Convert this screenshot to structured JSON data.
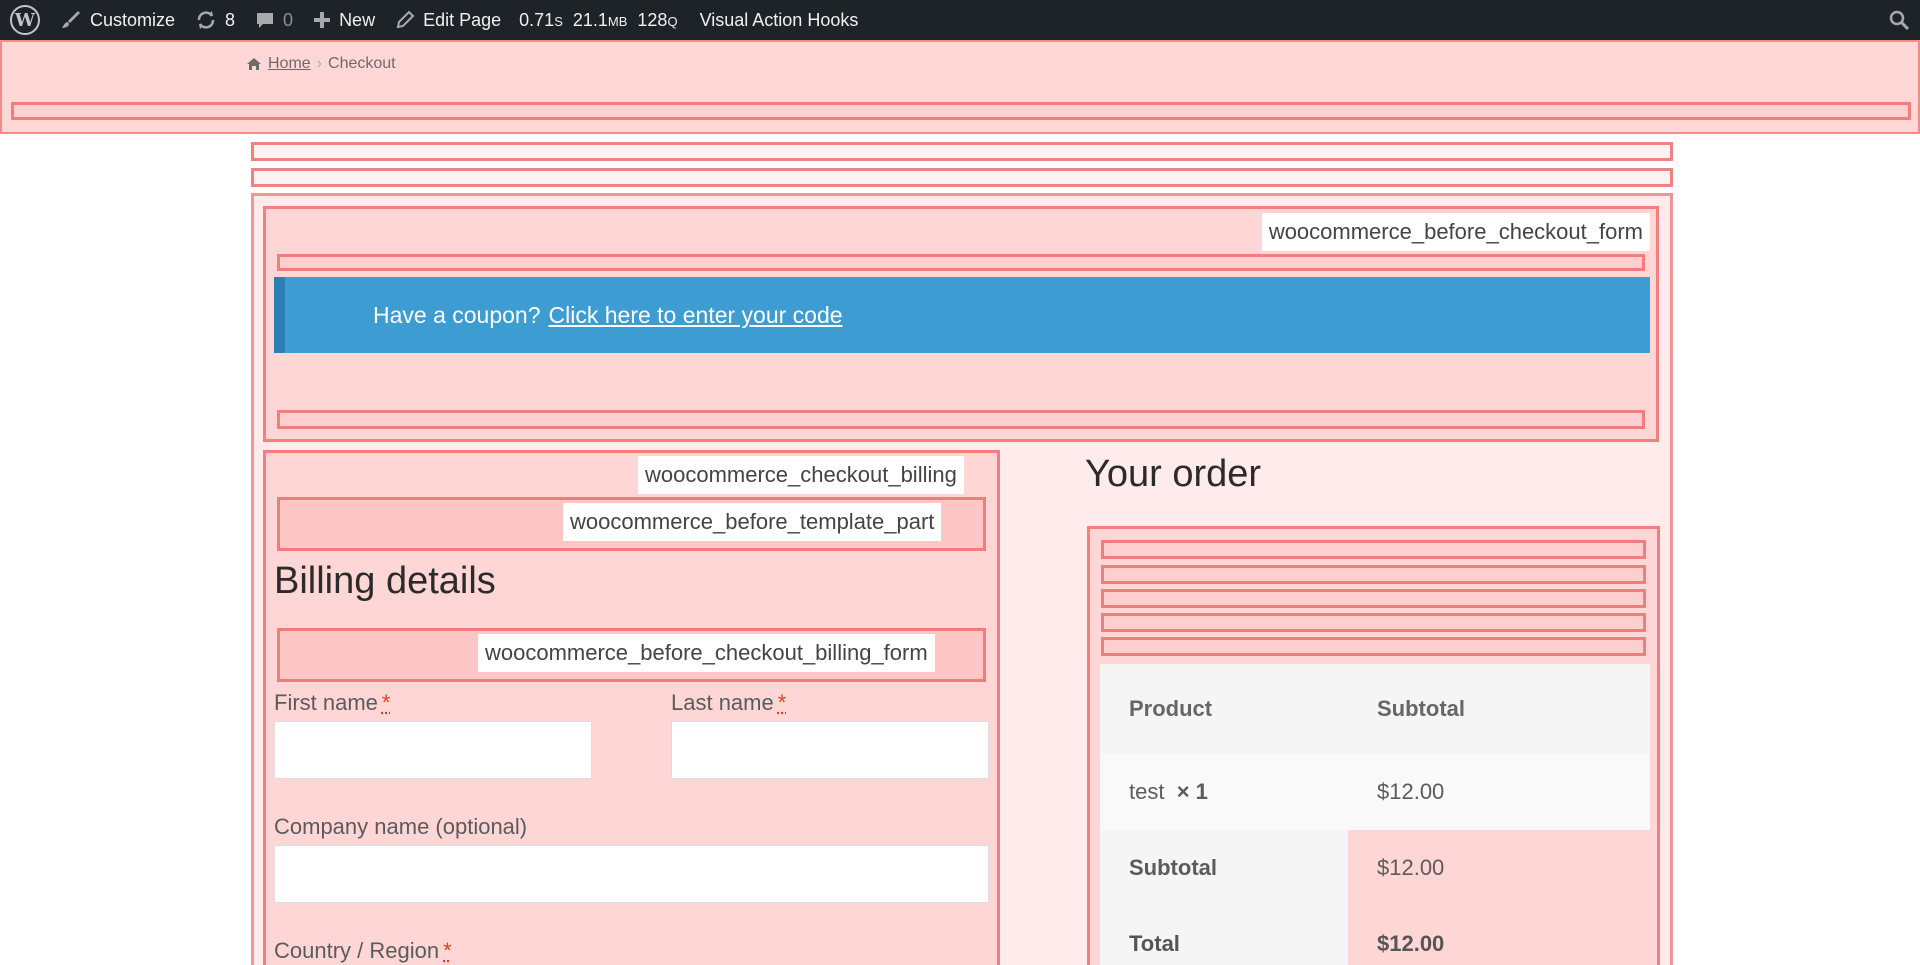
{
  "adminbar": {
    "customize_label": "Customize",
    "updates_count": "8",
    "comments_count": "0",
    "new_label": "New",
    "edit_page_label": "Edit Page",
    "query_time": "0.71",
    "query_time_unit": "S",
    "memory": "21.1",
    "memory_unit": "MB",
    "queries": "128",
    "queries_unit": "Q",
    "plugin_label": "Visual Action Hooks"
  },
  "breadcrumb": {
    "home": "Home",
    "separator": "›",
    "current": "Checkout"
  },
  "hooks": {
    "before_checkout_form": "woocommerce_before_checkout_form",
    "checkout_billing": "woocommerce_checkout_billing",
    "before_template_part": "woocommerce_before_template_part",
    "before_checkout_billing_form": "woocommerce_before_checkout_billing_form"
  },
  "coupon": {
    "prefix": "Have a coupon?",
    "link": "Click here to enter your code"
  },
  "billing": {
    "title": "Billing details",
    "first_name": "First name",
    "last_name": "Last name",
    "company": "Company name (optional)",
    "country": "Country / Region",
    "required_mark": "*"
  },
  "order": {
    "title": "Your order",
    "headers": {
      "product": "Product",
      "subtotal": "Subtotal"
    },
    "item": {
      "name": "test",
      "qty": "× 1",
      "price": "$12.00"
    },
    "subtotal_label": "Subtotal",
    "subtotal_value": "$12.00",
    "total_label": "Total",
    "total_value": "$12.00"
  },
  "colors": {
    "adminbar": "#1d2327",
    "notice": "#3d9cd2",
    "hook_border": "#f06e6e",
    "required": "#e2401c"
  }
}
